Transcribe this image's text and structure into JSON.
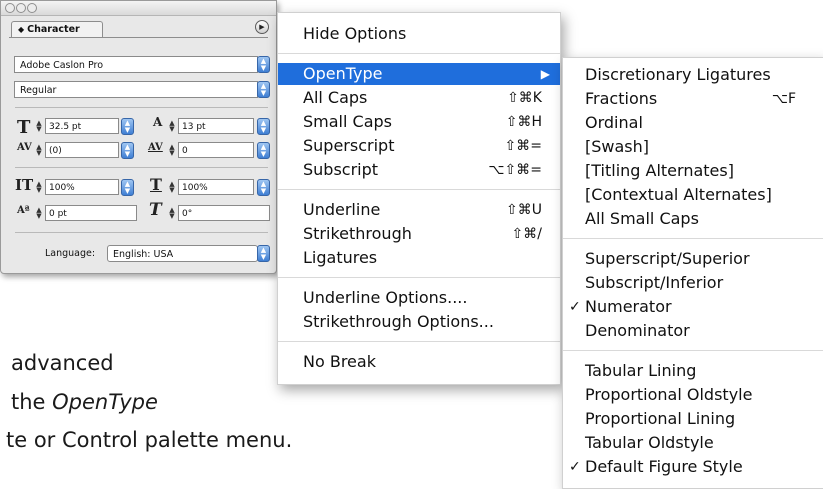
{
  "background_text": {
    "line1": "advanced",
    "line2_prefix": "the ",
    "line2_italic": "OpenType",
    "line3": "te or Control palette menu."
  },
  "palette": {
    "tab_label": "Character",
    "font_family": "Adobe Caslon Pro",
    "font_style": "Regular",
    "font_size": "32.5 pt",
    "leading": "13 pt",
    "kerning": "(0)",
    "tracking": "0",
    "vertical_scale": "100%",
    "horizontal_scale": "100%",
    "baseline_shift": "0 pt",
    "skew": "0°",
    "language_label": "Language:",
    "language_value": "English: USA"
  },
  "menu": {
    "items": [
      {
        "label": "Hide Options",
        "shortcut": ""
      },
      {
        "label": "OpenType",
        "shortcut": "",
        "submenu": true,
        "highlighted": true
      },
      {
        "label": "All Caps",
        "shortcut": "⇧⌘K"
      },
      {
        "label": "Small Caps",
        "shortcut": "⇧⌘H"
      },
      {
        "label": "Superscript",
        "shortcut": "⇧⌘="
      },
      {
        "label": "Subscript",
        "shortcut": "⌥⇧⌘="
      },
      {
        "label": "Underline",
        "shortcut": "⇧⌘U"
      },
      {
        "label": "Strikethrough",
        "shortcut": "⇧⌘/"
      },
      {
        "label": "Ligatures",
        "shortcut": ""
      },
      {
        "label": "Underline Options....",
        "shortcut": ""
      },
      {
        "label": "Strikethrough Options...",
        "shortcut": ""
      },
      {
        "label": "No Break",
        "shortcut": ""
      }
    ]
  },
  "submenu": {
    "items": [
      {
        "label": "Discretionary Ligatures",
        "shortcut": "",
        "checked": false
      },
      {
        "label": "Fractions",
        "shortcut": "⌥F",
        "checked": false
      },
      {
        "label": "Ordinal",
        "shortcut": "",
        "checked": false
      },
      {
        "label": "[Swash]",
        "shortcut": "",
        "checked": false
      },
      {
        "label": "[Titling Alternates]",
        "shortcut": "",
        "checked": false
      },
      {
        "label": "[Contextual Alternates]",
        "shortcut": "",
        "checked": false
      },
      {
        "label": "All Small Caps",
        "shortcut": "",
        "checked": false
      },
      {
        "label": "Superscript/Superior",
        "shortcut": "",
        "checked": false
      },
      {
        "label": "Subscript/Inferior",
        "shortcut": "",
        "checked": false
      },
      {
        "label": "Numerator",
        "shortcut": "",
        "checked": true
      },
      {
        "label": "Denominator",
        "shortcut": "",
        "checked": false
      },
      {
        "label": "Tabular Lining",
        "shortcut": "",
        "checked": false
      },
      {
        "label": "Proportional Oldstyle",
        "shortcut": "",
        "checked": false
      },
      {
        "label": "Proportional Lining",
        "shortcut": "",
        "checked": false
      },
      {
        "label": "Tabular Oldstyle",
        "shortcut": "",
        "checked": false
      },
      {
        "label": "Default Figure Style",
        "shortcut": "",
        "checked": true
      }
    ],
    "check_glyph": "✓"
  },
  "colors": {
    "highlight": "#1f6edc"
  }
}
